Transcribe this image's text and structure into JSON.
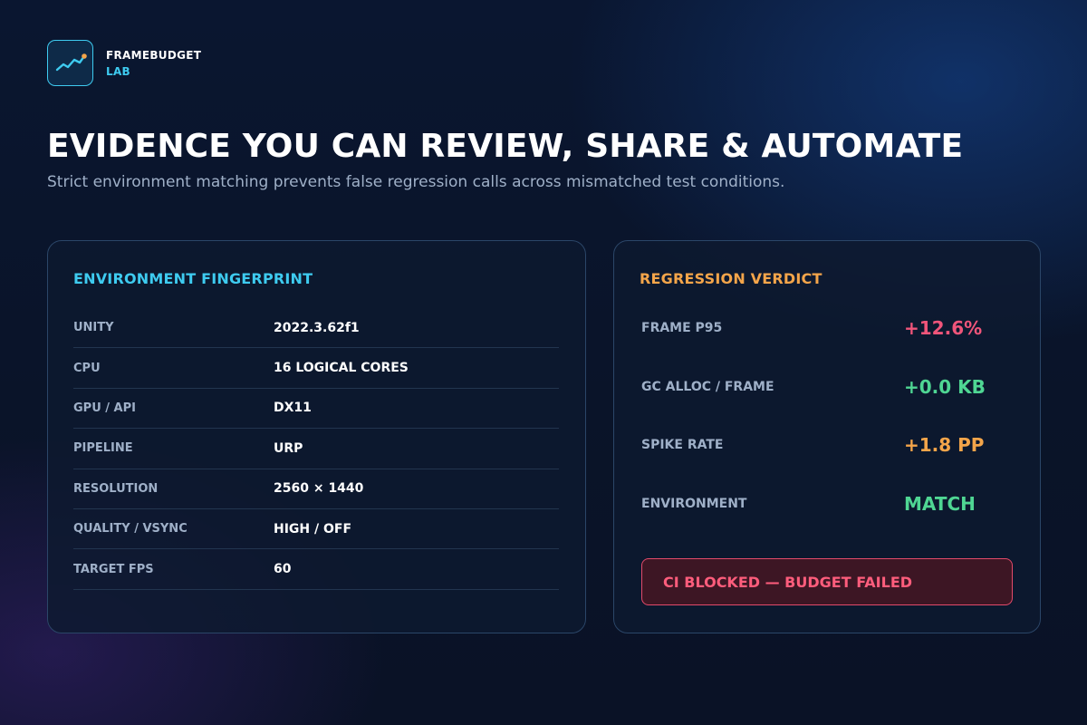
{
  "brand": {
    "name": "FRAMEBUDGET",
    "sub": "LAB",
    "logo_icon": "trending-line-icon",
    "accent": "#3ecbf0"
  },
  "hero": {
    "title": "EVIDENCE YOU CAN REVIEW, SHARE & AUTOMATE",
    "subtitle": "Strict environment matching prevents false regression calls across mismatched test conditions."
  },
  "environment": {
    "title": "ENVIRONMENT FINGERPRINT",
    "rows": [
      {
        "label": "UNITY",
        "value": "2022.3.62f1"
      },
      {
        "label": "CPU",
        "value": "16 LOGICAL CORES"
      },
      {
        "label": "GPU / API",
        "value": "DX11"
      },
      {
        "label": "PIPELINE",
        "value": "URP"
      },
      {
        "label": "RESOLUTION",
        "value": "2560 × 1440"
      },
      {
        "label": "QUALITY / VSYNC",
        "value": "HIGH / OFF"
      },
      {
        "label": "TARGET FPS",
        "value": "60"
      }
    ]
  },
  "verdict": {
    "title": "REGRESSION VERDICT",
    "metrics": [
      {
        "label": "FRAME P95",
        "value": "+12.6%",
        "color": "#f0557a"
      },
      {
        "label": "GC ALLOC / FRAME",
        "value": "+0.0 KB",
        "color": "#4fd693"
      },
      {
        "label": "SPIKE RATE",
        "value": "+1.8 PP",
        "color": "#f4a54a"
      },
      {
        "label": "ENVIRONMENT",
        "value": "MATCH",
        "color": "#4fd693"
      }
    ],
    "ci_status": "CI BLOCKED — BUDGET FAILED"
  },
  "colors": {
    "env_title": "#3ecbf0",
    "verdict_title": "#f4a54a",
    "danger": "#ff5d7c"
  }
}
